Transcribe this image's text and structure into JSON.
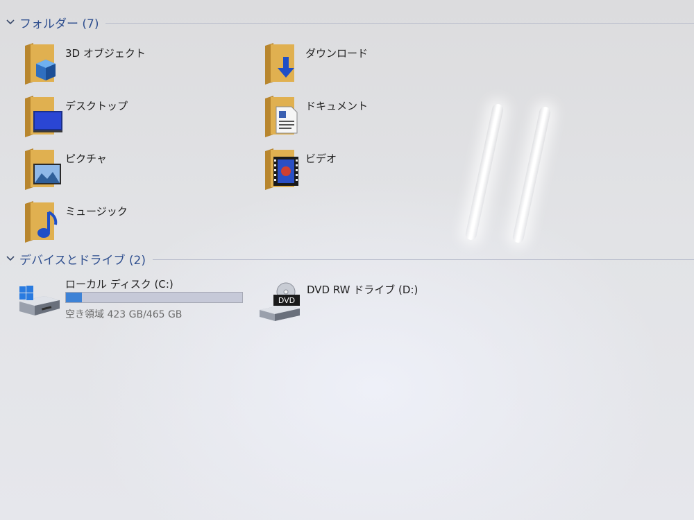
{
  "folders_section": {
    "title": "フォルダー (7)",
    "items": [
      {
        "label": "3D オブジェクト",
        "icon": "folder-3d-objects-icon"
      },
      {
        "label": "ダウンロード",
        "icon": "folder-downloads-icon"
      },
      {
        "label": "デスクトップ",
        "icon": "folder-desktop-icon"
      },
      {
        "label": "ドキュメント",
        "icon": "folder-documents-icon"
      },
      {
        "label": "ピクチャ",
        "icon": "folder-pictures-icon"
      },
      {
        "label": "ビデオ",
        "icon": "folder-videos-icon"
      },
      {
        "label": "ミュージック",
        "icon": "folder-music-icon"
      }
    ]
  },
  "devices_section": {
    "title": "デバイスとドライブ (2)",
    "drives": [
      {
        "name": "ローカル ディスク (C:)",
        "free_text": "空き領域 423 GB/465 GB",
        "free_gb": 423,
        "total_gb": 465,
        "used_fraction": 0.09,
        "icon": "windows-drive-icon"
      },
      {
        "name": "DVD RW ドライブ (D:)",
        "icon": "dvd-drive-icon",
        "icon_text": "DVD"
      }
    ]
  },
  "colors": {
    "header_text": "#2f4f8f",
    "folder": "#e0b050",
    "usage_bar": "#3d82d6"
  }
}
